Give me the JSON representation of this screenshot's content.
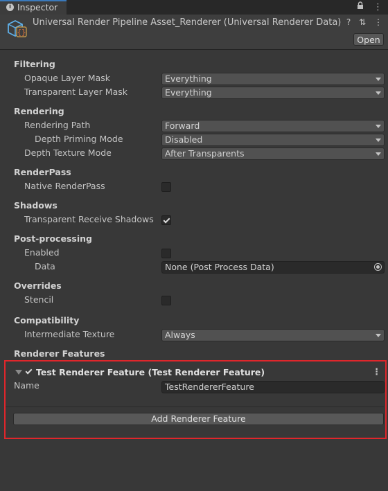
{
  "tab": {
    "label": "Inspector",
    "lock_icon": "lock-icon",
    "menu_icon": "kebab-menu-icon"
  },
  "header": {
    "title": "Universal Render Pipeline Asset_Renderer (Universal Renderer Data)",
    "help_glyph": "?",
    "settings_glyph": "⇅",
    "menu_glyph": "⋮",
    "open_label": "Open"
  },
  "filtering": {
    "title": "Filtering",
    "opaque_label": "Opaque Layer Mask",
    "opaque_value": "Everything",
    "transparent_label": "Transparent Layer Mask",
    "transparent_value": "Everything"
  },
  "rendering": {
    "title": "Rendering",
    "path_label": "Rendering Path",
    "path_value": "Forward",
    "priming_label": "Depth Priming Mode",
    "priming_value": "Disabled",
    "depth_tex_label": "Depth Texture Mode",
    "depth_tex_value": "After Transparents"
  },
  "renderpass": {
    "title": "RenderPass",
    "native_label": "Native RenderPass",
    "native_checked": false
  },
  "shadows": {
    "title": "Shadows",
    "receive_label": "Transparent Receive Shadows",
    "receive_checked": true
  },
  "postprocessing": {
    "title": "Post-processing",
    "enabled_label": "Enabled",
    "enabled_checked": false,
    "data_label": "Data",
    "data_value": "None (Post Process Data)"
  },
  "overrides": {
    "title": "Overrides",
    "stencil_label": "Stencil",
    "stencil_checked": false
  },
  "compatibility": {
    "title": "Compatibility",
    "intermediate_label": "Intermediate Texture",
    "intermediate_value": "Always"
  },
  "features": {
    "title": "Renderer Features",
    "feature_title": "Test Renderer Feature (Test Renderer Feature)",
    "feature_enabled": true,
    "name_label": "Name",
    "name_value": "TestRendererFeature",
    "add_label": "Add Renderer Feature"
  },
  "colors": {
    "background": "#383838",
    "highlight_border": "#e0262b",
    "accent": "#3a79bb"
  }
}
